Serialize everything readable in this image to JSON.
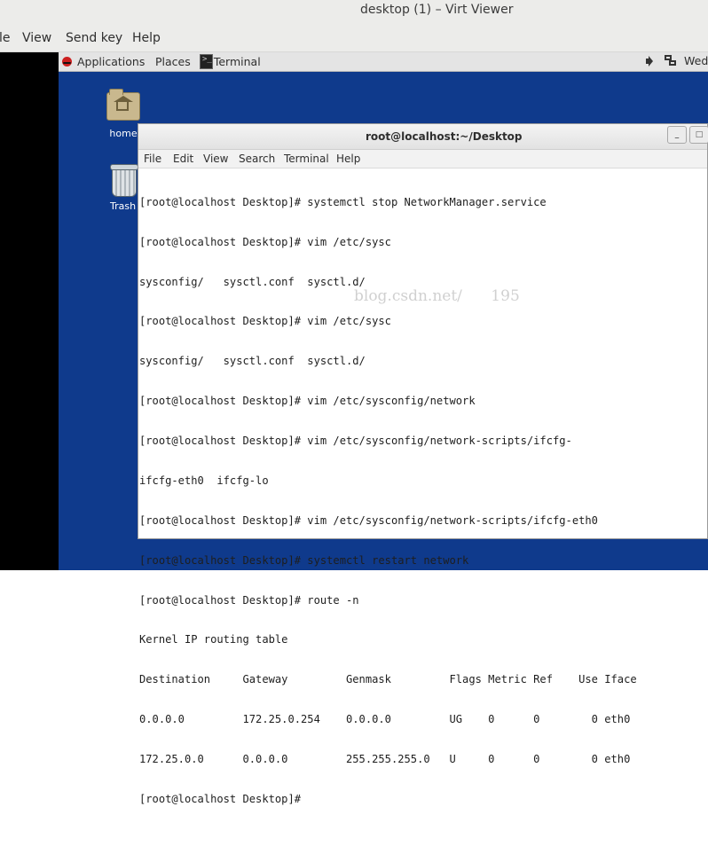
{
  "window": {
    "title": "desktop (1) – Virt Viewer"
  },
  "menubar": {
    "items": [
      "le",
      "View",
      "Send key",
      "Help"
    ]
  },
  "topbar": {
    "applications": "Applications",
    "places": "Places",
    "task_label": "Terminal",
    "clock_fragment": "Wed"
  },
  "desktop_icons": [
    {
      "label": "home",
      "icon": "home-folder-icon"
    },
    {
      "label": "Trash",
      "icon": "trash-icon"
    }
  ],
  "terminal": {
    "title": "root@localhost:~/Desktop",
    "menu": [
      "File",
      "Edit",
      "View",
      "Search",
      "Terminal",
      "Help"
    ],
    "lines": [
      "[root@localhost Desktop]# systemctl stop NetworkManager.service",
      "[root@localhost Desktop]# vim /etc/sysc",
      "sysconfig/   sysctl.conf  sysctl.d/",
      "[root@localhost Desktop]# vim /etc/sysc",
      "sysconfig/   sysctl.conf  sysctl.d/",
      "[root@localhost Desktop]# vim /etc/sysconfig/network",
      "[root@localhost Desktop]# vim /etc/sysconfig/network-scripts/ifcfg-",
      "ifcfg-eth0  ifcfg-lo",
      "[root@localhost Desktop]# vim /etc/sysconfig/network-scripts/ifcfg-eth0",
      "[root@localhost Desktop]# systemctl restart network",
      "[root@localhost Desktop]# route -n",
      "Kernel IP routing table",
      "Destination     Gateway         Genmask         Flags Metric Ref    Use Iface",
      "0.0.0.0         172.25.0.254    0.0.0.0         UG    0      0        0 eth0",
      "172.25.0.0      0.0.0.0         255.255.255.0   U     0      0        0 eth0",
      "[root@localhost Desktop]#"
    ],
    "watermark": "blog.csdn.net/      195"
  },
  "colors": {
    "desktop_bg": "#0f3a8c",
    "chrome_bg": "#ececea",
    "terminal_bg": "#ffffff"
  }
}
